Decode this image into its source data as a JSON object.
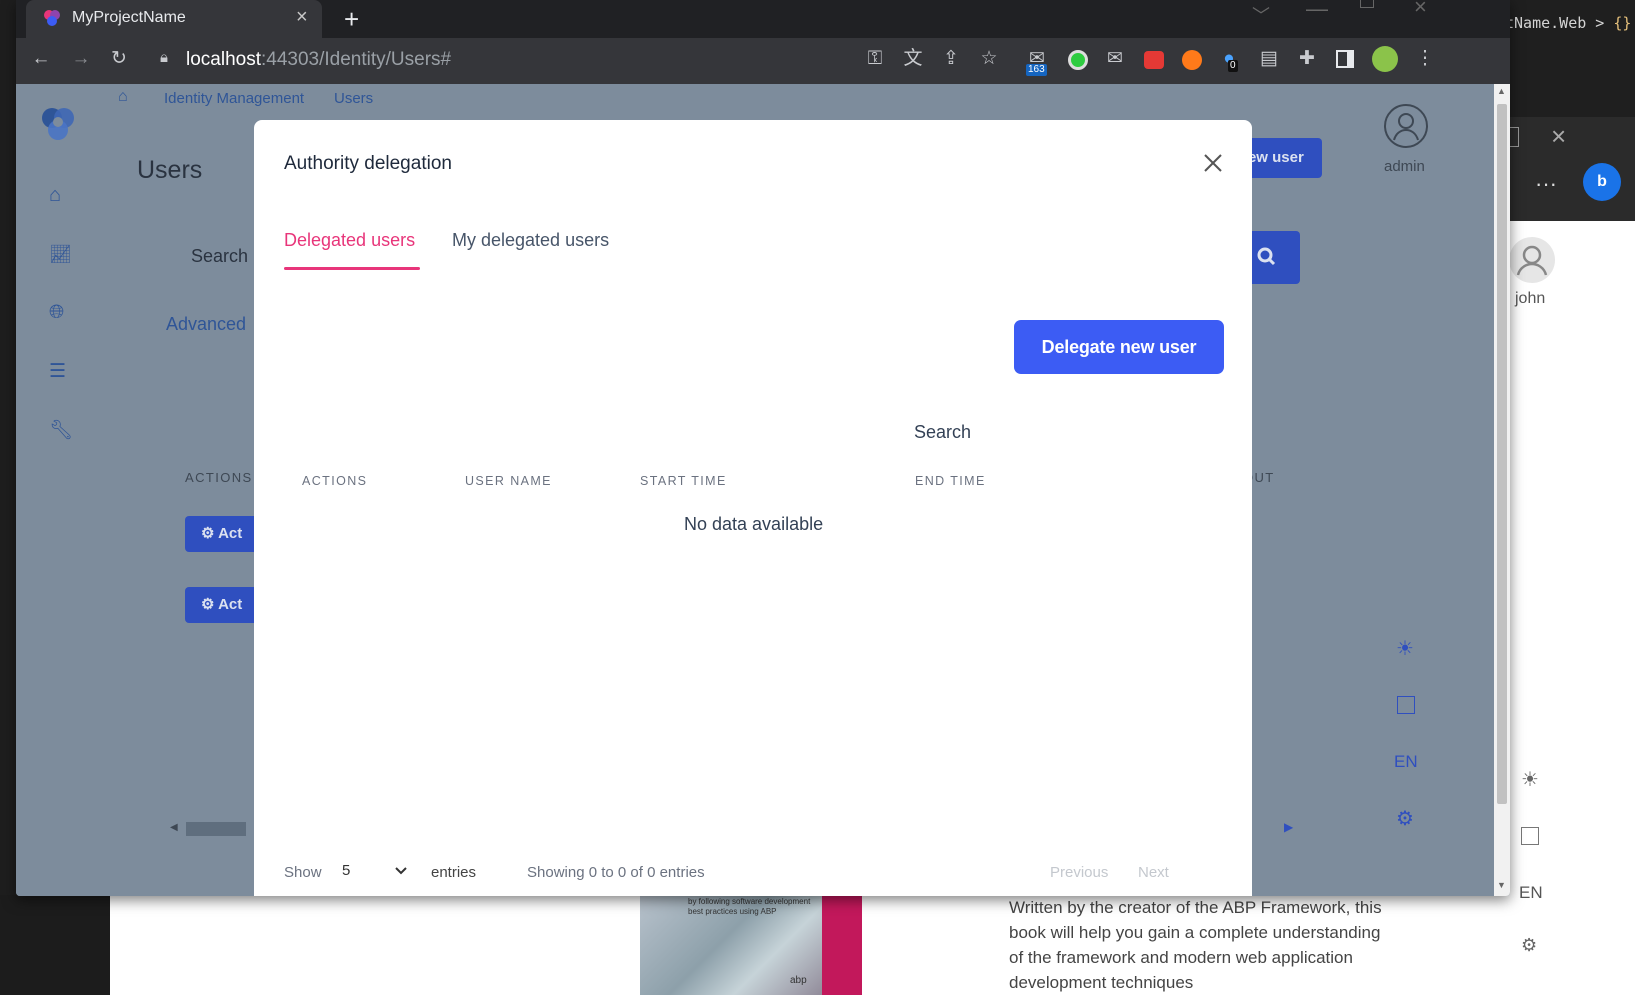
{
  "browser": {
    "tab_title": "MyProjectName",
    "url_host": "localhost",
    "url_rest": ":44303/Identity/Users#",
    "badge_163": "163",
    "badge_0": "0"
  },
  "background": {
    "vscode_crumb": "tName.Web >",
    "vscode_brace": "{}",
    "edge_user": "john",
    "edge_lang": "EN",
    "book_cover_text_1": "by following software development",
    "book_cover_text_2": "best practices using ABP",
    "book_brand": "abp",
    "book_description": "Written by the creator of the ABP Framework, this book will help you gain a complete understanding of the framework and modern web application development techniques"
  },
  "app": {
    "breadcrumb": [
      "Identity Management",
      "Users"
    ],
    "page_title": "Users",
    "new_user_btn": "New user",
    "user_name": "admin",
    "search_placeholder": "Search",
    "advanced_link": "Advanced",
    "col_actions": "ACTIONS",
    "col_lockout": "LOCKOUT",
    "action_btn": "Act",
    "lang": "EN"
  },
  "modal": {
    "title": "Authority delegation",
    "tabs": [
      "Delegated users",
      "My delegated users"
    ],
    "active_tab": 0,
    "delegate_btn": "Delegate new user",
    "search_label": "Search",
    "columns": [
      "ACTIONS",
      "USER NAME",
      "START TIME",
      "END TIME"
    ],
    "empty_text": "No data available",
    "show_label": "Show",
    "page_size": "5",
    "entries_label": "entries",
    "info": "Showing 0 to 0 of 0 entries",
    "prev": "Previous",
    "next": "Next"
  },
  "colors": {
    "accent_pink": "#e8357a",
    "primary_blue": "#3c5cf4",
    "overlay": "#7d8c9c"
  }
}
